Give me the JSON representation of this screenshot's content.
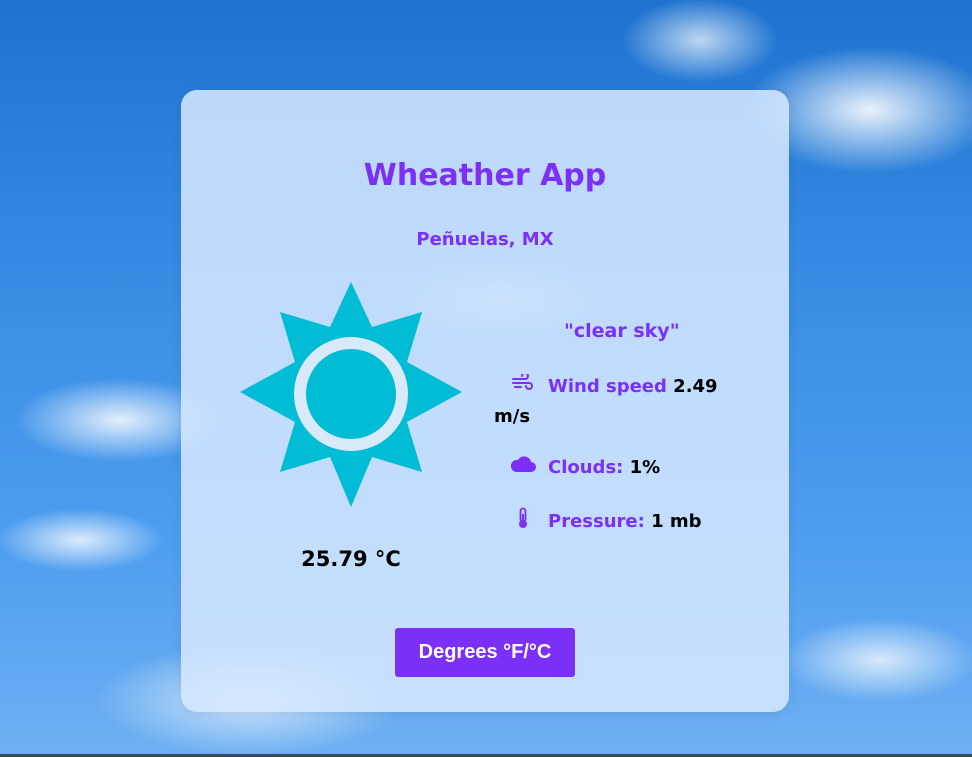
{
  "app": {
    "title": "Wheather App",
    "location": "Peñuelas, MX"
  },
  "weather": {
    "icon": "sun-icon",
    "temperature": "25.79 °C",
    "description": "\"clear sky\"",
    "wind": {
      "icon": "wind-icon",
      "label": "Wind speed",
      "value_line1": "2.49",
      "value_line2": "m/s"
    },
    "clouds": {
      "icon": "cloud-icon",
      "label": "Clouds:",
      "value": "1%"
    },
    "pressure": {
      "icon": "thermometer-icon",
      "label": "Pressure:",
      "value": "1 mb"
    }
  },
  "controls": {
    "toggle_label": "Degrees °F/°C"
  },
  "colors": {
    "accent": "#7b2ff7",
    "sun": "#00bcd4",
    "card": "#d6e8ff"
  }
}
